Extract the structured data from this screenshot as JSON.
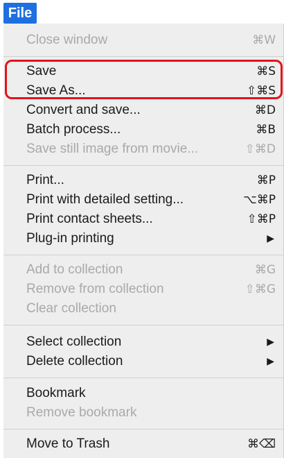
{
  "menu": {
    "title": "File",
    "items": [
      {
        "label": "Close window",
        "shortcut": "⌘W"
      },
      {
        "label": "Save",
        "shortcut": "⌘S"
      },
      {
        "label": "Save As...",
        "shortcut": "⇧⌘S"
      },
      {
        "label": "Convert and save...",
        "shortcut": "⌘D"
      },
      {
        "label": "Batch process...",
        "shortcut": "⌘B"
      },
      {
        "label": "Save still image from movie...",
        "shortcut": "⇧⌘D"
      },
      {
        "label": "Print...",
        "shortcut": "⌘P"
      },
      {
        "label": "Print with detailed setting...",
        "shortcut": "⌥⌘P"
      },
      {
        "label": "Print contact sheets...",
        "shortcut": "⇧⌘P"
      },
      {
        "label": "Plug-in printing",
        "shortcut": "▶"
      },
      {
        "label": "Add to collection",
        "shortcut": "⌘G"
      },
      {
        "label": "Remove from collection",
        "shortcut": "⇧⌘G"
      },
      {
        "label": "Clear collection",
        "shortcut": ""
      },
      {
        "label": "Select collection",
        "shortcut": "▶"
      },
      {
        "label": "Delete collection",
        "shortcut": "▶"
      },
      {
        "label": "Bookmark",
        "shortcut": ""
      },
      {
        "label": "Remove bookmark",
        "shortcut": ""
      },
      {
        "label": "Move to Trash",
        "shortcut": "⌘⌫"
      }
    ]
  }
}
